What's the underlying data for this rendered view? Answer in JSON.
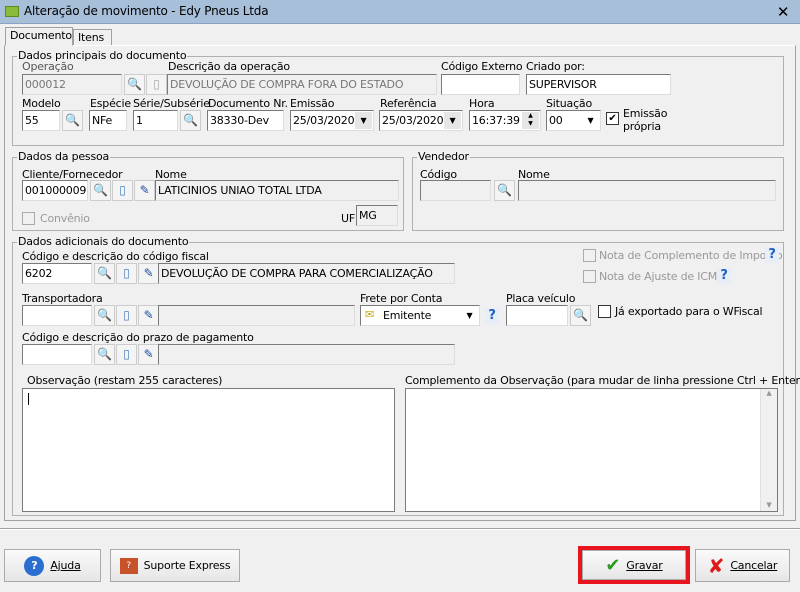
{
  "window": {
    "title": "Alteração de movimento - Edy Pneus Ltda",
    "close": "✕"
  },
  "tabs": [
    "Documento",
    "Itens"
  ],
  "principal": {
    "legend": "Dados principais do documento",
    "operacao_label": "Operação",
    "operacao": "000012",
    "descricao_label": "Descrição da operação",
    "descricao": "DEVOLUÇÃO DE COMPRA FORA DO ESTADO",
    "codigo_externo_label": "Código Externo",
    "codigo_externo": "",
    "criado_label": "Criado por:",
    "criado": "SUPERVISOR",
    "modelo_label": "Modelo",
    "modelo": "55",
    "especie_label": "Espécie",
    "especie": "NFe",
    "serie_label": "Série/Subsérie",
    "serie": "1",
    "documento_label": "Documento Nr.",
    "documento": "38330-Dev",
    "emissao_label": "Emissão",
    "emissao": "25/03/2020",
    "referencia_label": "Referência",
    "referencia": "25/03/2020",
    "hora_label": "Hora",
    "hora": "16:37:39",
    "situacao_label": "Situação",
    "situacao": "00",
    "emissao_propria_1": "Emissão",
    "emissao_propria_2": "própria"
  },
  "pessoa": {
    "legend": "Dados da pessoa",
    "cliente_label": "Cliente/Fornecedor",
    "cliente": "001000009",
    "nome_label": "Nome",
    "nome": "LATICINIOS UNIAO TOTAL LTDA",
    "convenio": "Convênio",
    "uf_label": "UF",
    "uf": "MG"
  },
  "vendedor": {
    "legend": "Vendedor",
    "codigo_label": "Código",
    "codigo": "",
    "nome_label": "Nome",
    "nome": ""
  },
  "adicionais": {
    "legend": "Dados adicionais do documento",
    "cfop_label": "Código e descrição do código fiscal",
    "cfop": "6202",
    "cfop_desc": "DEVOLUÇÃO DE COMPRA PARA COMERCIALIZAÇÃO",
    "nota_complemento": "Nota de Complemento de Imposto",
    "nota_ajuste": "Nota de Ajuste de ICMS",
    "transportadora_label": "Transportadora",
    "frete_label": "Frete por Conta",
    "frete": "Emitente",
    "placa_label": "Placa veículo",
    "exportado": "Já exportado para o WFiscal",
    "prazo_label": "Código e descrição do prazo de pagamento",
    "observacao_label": "Observação (restam 255 caracteres)",
    "complemento_label": "Complemento da Observação (para mudar de linha pressione Ctrl + Enter)"
  },
  "buttons": {
    "ajuda": "Ajuda",
    "suporte": "Suporte Express",
    "gravar": "Gravar",
    "cancelar": "Cancelar"
  },
  "colors": {
    "highlight": "#e8141e",
    "title_bar": "#a8bfd9"
  }
}
